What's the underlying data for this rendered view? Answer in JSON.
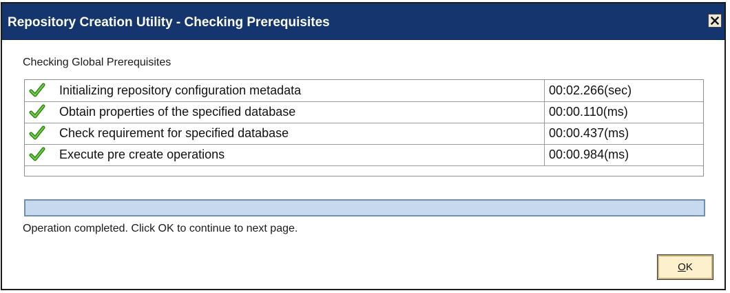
{
  "window": {
    "title": "Repository Creation Utility - Checking Prerequisites",
    "close_icon": "close-icon"
  },
  "section_label": "Checking Global Prerequisites",
  "checks": [
    {
      "icon": "checkmark-icon",
      "name": "Initializing repository configuration metadata",
      "time": "00:02.266(sec)"
    },
    {
      "icon": "checkmark-icon",
      "name": "Obtain properties of the specified database",
      "time": "00:00.110(ms)"
    },
    {
      "icon": "checkmark-icon",
      "name": "Check requirement for specified database",
      "time": "00:00.437(ms)"
    },
    {
      "icon": "checkmark-icon",
      "name": "Execute pre create operations",
      "time": "00:00.984(ms)"
    }
  ],
  "progress": {
    "fraction": 1.0
  },
  "status_text": "Operation completed. Click OK to continue to next page.",
  "ok_button": {
    "mnemonic": "O",
    "rest": "K"
  },
  "colors": {
    "titlebar": "#14356e",
    "check_green": "#3a9a1e",
    "progress_fill": "#c6d9ee",
    "ok_button_bg": "#fdf0cc"
  }
}
